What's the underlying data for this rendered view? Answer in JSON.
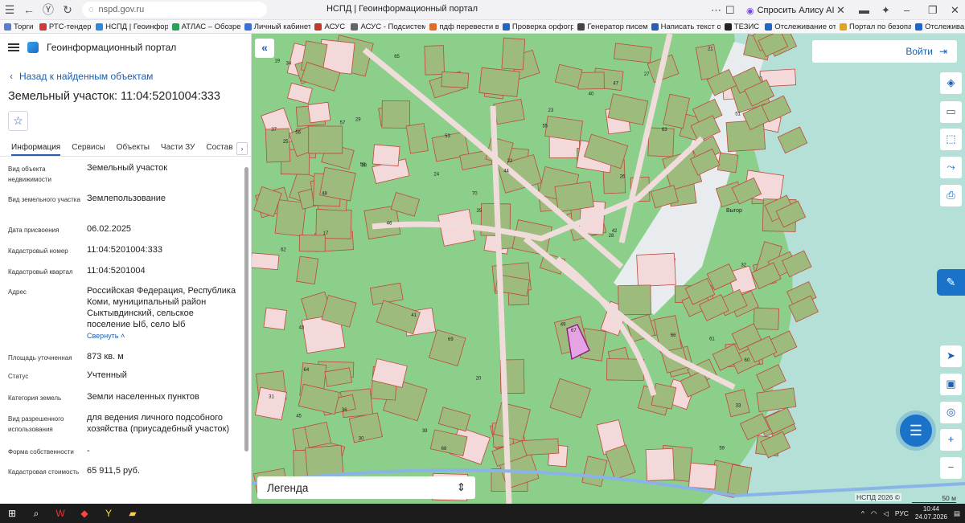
{
  "browser": {
    "url": "nspd.gov.ru",
    "tab_title": "НСПД | Геоинформационный портал",
    "alice_label": "Спросить Алису AI",
    "bookmarks": [
      {
        "label": "Торги",
        "color": "#5a7bd6"
      },
      {
        "label": "РТС-тендер",
        "color": "#d23a3a"
      },
      {
        "label": "НСПД | Геоинфор",
        "color": "#2a8ae0"
      },
      {
        "label": "АТЛАС – Обозре",
        "color": "#2b9e5a"
      },
      {
        "label": "Личный кабинет",
        "color": "#3b6fd1"
      },
      {
        "label": "АСУС",
        "color": "#c0392b"
      },
      {
        "label": "АСУС - Подсистем",
        "color": "#666666"
      },
      {
        "label": "пдф перевести в",
        "color": "#e06b2a"
      },
      {
        "label": "Проверка орфогр",
        "color": "#1e66c8"
      },
      {
        "label": "Генератор писем",
        "color": "#444444"
      },
      {
        "label": "Написать текст о",
        "color": "#2a5db0"
      },
      {
        "label": "ТЕЗИС",
        "color": "#222222"
      },
      {
        "label": "Отслеживание от",
        "color": "#1e66c8"
      },
      {
        "label": "Портал по безопа",
        "color": "#e0a02a"
      },
      {
        "label": "Отслежива",
        "color": "#1e66c8"
      }
    ]
  },
  "panel": {
    "portal_name": "Геоинформационный портал",
    "back_label": "Назад к найденным объектам",
    "title": "Земельный участок: 11:04:5201004:333",
    "tabs": [
      "Информация",
      "Сервисы",
      "Объекты",
      "Части ЗУ",
      "Состав"
    ],
    "active_tab": "Информация",
    "collapse_label": "Свернуть",
    "fields": [
      {
        "label": "Вид объекта недвижимости",
        "value": "Земельный участок"
      },
      {
        "label": "Вид земельного участка",
        "value": "Землепользование"
      },
      {
        "label": "Дата присвоения",
        "value": "06.02.2025"
      },
      {
        "label": "Кадастровый номер",
        "value": "11:04:5201004:333"
      },
      {
        "label": "Кадастровый квартал",
        "value": "11:04:5201004"
      },
      {
        "label": "Адрес",
        "value": "Российская Федерация, Республика Коми, муниципальный район Сыктывдинский, сельское поселение Ыб, село Ыб"
      },
      {
        "label": "Площадь уточненная",
        "value": "873 кв. м"
      },
      {
        "label": "Статус",
        "value": "Учтенный"
      },
      {
        "label": "Категория земель",
        "value": "Земли населенных пунктов"
      },
      {
        "label": "Вид разрешенного использования",
        "value": "для ведения личного подсобного хозяйства (приусадебный участок)"
      },
      {
        "label": "Форма собственности",
        "value": "-"
      },
      {
        "label": "Кадастровая стоимость",
        "value": "65 911,5 руб."
      }
    ]
  },
  "map": {
    "login_label": "Войти",
    "legend_label": "Легенда",
    "copyright": "НСПД 2026 ©",
    "scale": "50 м",
    "place_label": "Выгор",
    "parcel_labels": [
      "39",
      "38",
      "36",
      "35",
      "37",
      "34",
      "32",
      "53",
      "46",
      "41",
      "49",
      "48",
      "47",
      "45",
      "51",
      "55",
      "56",
      "57",
      "58",
      "59",
      "60",
      "61",
      "62",
      "63",
      "64",
      "40",
      "33",
      "31",
      "29",
      "27",
      "25",
      "21",
      "23",
      "22",
      "30",
      "28",
      "26",
      "24",
      "44",
      "43",
      "42",
      "65",
      "66",
      "67",
      "68",
      "69",
      "70",
      "17",
      "19",
      "20"
    ]
  },
  "taskbar": {
    "lang": "РУС",
    "time": "10:44",
    "date": "24.07.2026"
  }
}
